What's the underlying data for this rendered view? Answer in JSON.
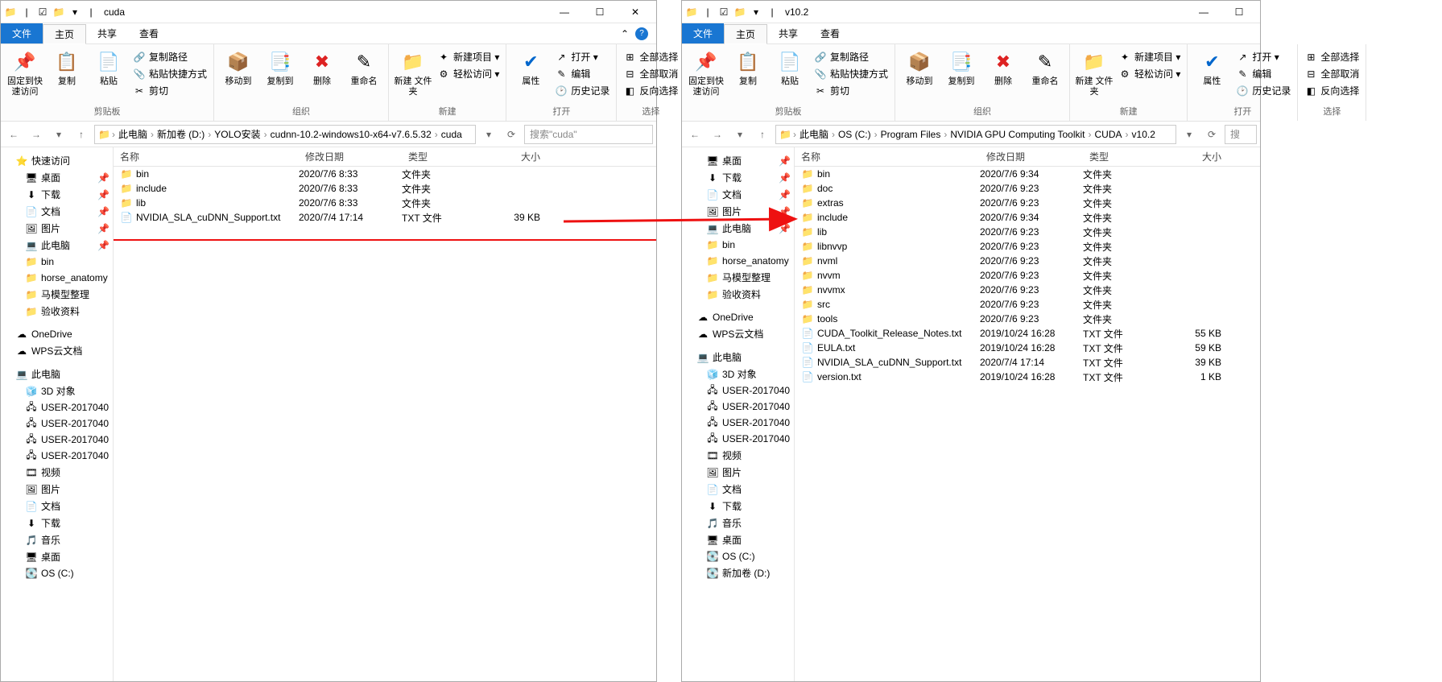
{
  "left": {
    "title": "cuda",
    "tabs": {
      "file": "文件",
      "home": "主页",
      "share": "共享",
      "view": "查看"
    },
    "ribbon": {
      "g1_label": "剪贴板",
      "pin": "固定到快\n速访问",
      "copy": "复制",
      "paste": "粘贴",
      "copypath": "复制路径",
      "pasteshortcut": "粘贴快捷方式",
      "cut": "剪切",
      "g2_label": "组织",
      "moveto": "移动到",
      "copyto": "复制到",
      "delete": "删除",
      "rename": "重命名",
      "g3_label": "新建",
      "newfolder": "新建\n文件夹",
      "newitem": "新建项目 ▾",
      "easyaccess": "轻松访问 ▾",
      "g4_label": "打开",
      "properties": "属性",
      "open": "打开 ▾",
      "edit": "编辑",
      "history": "历史记录",
      "g5_label": "选择",
      "selall": "全部选择",
      "selnone": "全部取消",
      "selinv": "反向选择"
    },
    "breadcrumbs": [
      "此电脑",
      "新加卷 (D:)",
      "YOLO安装",
      "cudnn-10.2-windows10-x64-v7.6.5.32",
      "cuda"
    ],
    "search_ph": "搜索\"cuda\"",
    "cols": {
      "name": "名称",
      "date": "修改日期",
      "type": "类型",
      "size": "大小"
    },
    "sidebar": [
      {
        "i": "⭐",
        "t": "快速访问",
        "l": 0
      },
      {
        "i": "🖥",
        "t": "桌面",
        "l": 1,
        "pin": true
      },
      {
        "i": "⬇",
        "t": "下载",
        "l": 1,
        "pin": true
      },
      {
        "i": "📄",
        "t": "文档",
        "l": 1,
        "pin": true
      },
      {
        "i": "🖼",
        "t": "图片",
        "l": 1,
        "pin": true
      },
      {
        "i": "💻",
        "t": "此电脑",
        "l": 1,
        "pin": true
      },
      {
        "i": "📁",
        "t": "bin",
        "l": 1
      },
      {
        "i": "📁",
        "t": "horse_anatomy",
        "l": 1
      },
      {
        "i": "📁",
        "t": "马模型整理",
        "l": 1
      },
      {
        "i": "📁",
        "t": "验收资料",
        "l": 1
      },
      {
        "sp": true
      },
      {
        "i": "☁",
        "t": "OneDrive",
        "l": 0
      },
      {
        "i": "☁",
        "t": "WPS云文档",
        "l": 0
      },
      {
        "sp": true
      },
      {
        "i": "💻",
        "t": "此电脑",
        "l": 0
      },
      {
        "i": "🧊",
        "t": "3D 对象",
        "l": 1
      },
      {
        "i": "🖧",
        "t": "USER-2017040",
        "l": 1
      },
      {
        "i": "🖧",
        "t": "USER-2017040",
        "l": 1
      },
      {
        "i": "🖧",
        "t": "USER-2017040",
        "l": 1
      },
      {
        "i": "🖧",
        "t": "USER-2017040",
        "l": 1
      },
      {
        "i": "🎞",
        "t": "视频",
        "l": 1
      },
      {
        "i": "🖼",
        "t": "图片",
        "l": 1
      },
      {
        "i": "📄",
        "t": "文档",
        "l": 1
      },
      {
        "i": "⬇",
        "t": "下载",
        "l": 1
      },
      {
        "i": "🎵",
        "t": "音乐",
        "l": 1
      },
      {
        "i": "🖥",
        "t": "桌面",
        "l": 1
      },
      {
        "i": "💽",
        "t": "OS (C:)",
        "l": 1
      }
    ],
    "files": [
      {
        "icon": "📁",
        "cls": "folder-icon",
        "name": "bin",
        "date": "2020/7/6 8:33",
        "type": "文件夹",
        "size": ""
      },
      {
        "icon": "📁",
        "cls": "folder-icon",
        "name": "include",
        "date": "2020/7/6 8:33",
        "type": "文件夹",
        "size": ""
      },
      {
        "icon": "📁",
        "cls": "folder-icon",
        "name": "lib",
        "date": "2020/7/6 8:33",
        "type": "文件夹",
        "size": ""
      },
      {
        "icon": "📄",
        "cls": "txt-icon",
        "name": "NVIDIA_SLA_cuDNN_Support.txt",
        "date": "2020/7/4 17:14",
        "type": "TXT 文件",
        "size": "39 KB"
      }
    ]
  },
  "right": {
    "title": "v10.2",
    "breadcrumbs": [
      "此电脑",
      "OS (C:)",
      "Program Files",
      "NVIDIA GPU Computing Toolkit",
      "CUDA",
      "v10.2"
    ],
    "search_ph": "搜",
    "sidebar": [
      {
        "i": "🖥",
        "t": "桌面",
        "l": 1,
        "pin": true
      },
      {
        "i": "⬇",
        "t": "下载",
        "l": 1,
        "pin": true
      },
      {
        "i": "📄",
        "t": "文档",
        "l": 1,
        "pin": true
      },
      {
        "i": "🖼",
        "t": "图片",
        "l": 1,
        "pin": true
      },
      {
        "i": "💻",
        "t": "此电脑",
        "l": 1,
        "pin": true
      },
      {
        "i": "📁",
        "t": "bin",
        "l": 1
      },
      {
        "i": "📁",
        "t": "horse_anatomy",
        "l": 1
      },
      {
        "i": "📁",
        "t": "马模型整理",
        "l": 1
      },
      {
        "i": "📁",
        "t": "验收资料",
        "l": 1
      },
      {
        "sp": true
      },
      {
        "i": "☁",
        "t": "OneDrive",
        "l": 0
      },
      {
        "i": "☁",
        "t": "WPS云文档",
        "l": 0
      },
      {
        "sp": true
      },
      {
        "i": "💻",
        "t": "此电脑",
        "l": 0
      },
      {
        "i": "🧊",
        "t": "3D 对象",
        "l": 1
      },
      {
        "i": "🖧",
        "t": "USER-2017040",
        "l": 1
      },
      {
        "i": "🖧",
        "t": "USER-2017040",
        "l": 1
      },
      {
        "i": "🖧",
        "t": "USER-2017040",
        "l": 1
      },
      {
        "i": "🖧",
        "t": "USER-2017040",
        "l": 1
      },
      {
        "i": "🎞",
        "t": "视频",
        "l": 1
      },
      {
        "i": "🖼",
        "t": "图片",
        "l": 1
      },
      {
        "i": "📄",
        "t": "文档",
        "l": 1
      },
      {
        "i": "⬇",
        "t": "下载",
        "l": 1
      },
      {
        "i": "🎵",
        "t": "音乐",
        "l": 1
      },
      {
        "i": "🖥",
        "t": "桌面",
        "l": 1
      },
      {
        "i": "💽",
        "t": "OS (C:)",
        "l": 1
      },
      {
        "i": "💽",
        "t": "新加卷 (D:)",
        "l": 1
      }
    ],
    "files": [
      {
        "icon": "📁",
        "cls": "folder-icon",
        "name": "bin",
        "date": "2020/7/6 9:34",
        "type": "文件夹",
        "size": ""
      },
      {
        "icon": "📁",
        "cls": "folder-icon",
        "name": "doc",
        "date": "2020/7/6 9:23",
        "type": "文件夹",
        "size": ""
      },
      {
        "icon": "📁",
        "cls": "folder-icon",
        "name": "extras",
        "date": "2020/7/6 9:23",
        "type": "文件夹",
        "size": ""
      },
      {
        "icon": "📁",
        "cls": "folder-icon",
        "name": "include",
        "date": "2020/7/6 9:34",
        "type": "文件夹",
        "size": ""
      },
      {
        "icon": "📁",
        "cls": "folder-icon",
        "name": "lib",
        "date": "2020/7/6 9:23",
        "type": "文件夹",
        "size": ""
      },
      {
        "icon": "📁",
        "cls": "folder-icon",
        "name": "libnvvp",
        "date": "2020/7/6 9:23",
        "type": "文件夹",
        "size": ""
      },
      {
        "icon": "📁",
        "cls": "folder-icon",
        "name": "nvml",
        "date": "2020/7/6 9:23",
        "type": "文件夹",
        "size": ""
      },
      {
        "icon": "📁",
        "cls": "folder-icon",
        "name": "nvvm",
        "date": "2020/7/6 9:23",
        "type": "文件夹",
        "size": ""
      },
      {
        "icon": "📁",
        "cls": "folder-icon",
        "name": "nvvmx",
        "date": "2020/7/6 9:23",
        "type": "文件夹",
        "size": ""
      },
      {
        "icon": "📁",
        "cls": "folder-icon",
        "name": "src",
        "date": "2020/7/6 9:23",
        "type": "文件夹",
        "size": ""
      },
      {
        "icon": "📁",
        "cls": "folder-icon",
        "name": "tools",
        "date": "2020/7/6 9:23",
        "type": "文件夹",
        "size": ""
      },
      {
        "icon": "📄",
        "cls": "txt-icon",
        "name": "CUDA_Toolkit_Release_Notes.txt",
        "date": "2019/10/24 16:28",
        "type": "TXT 文件",
        "size": "55 KB"
      },
      {
        "icon": "📄",
        "cls": "txt-icon",
        "name": "EULA.txt",
        "date": "2019/10/24 16:28",
        "type": "TXT 文件",
        "size": "59 KB"
      },
      {
        "icon": "📄",
        "cls": "txt-icon",
        "name": "NVIDIA_SLA_cuDNN_Support.txt",
        "date": "2020/7/4 17:14",
        "type": "TXT 文件",
        "size": "39 KB"
      },
      {
        "icon": "📄",
        "cls": "txt-icon",
        "name": "version.txt",
        "date": "2019/10/24 16:28",
        "type": "TXT 文件",
        "size": "1 KB"
      }
    ]
  }
}
